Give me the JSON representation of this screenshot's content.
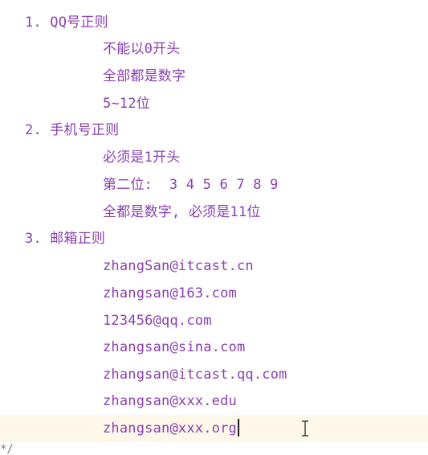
{
  "editor": {
    "lines": [
      {
        "kind": "heading",
        "text": "1. QQ号正则"
      },
      {
        "kind": "sub",
        "text": "不能以0开头"
      },
      {
        "kind": "sub",
        "text": "全部都是数字"
      },
      {
        "kind": "sub",
        "text": "5~12位"
      },
      {
        "kind": "heading",
        "text": "2. 手机号正则"
      },
      {
        "kind": "sub",
        "text": "必须是1开头"
      },
      {
        "kind": "sub",
        "text": "第二位:  3 4 5 6 7 8 9"
      },
      {
        "kind": "sub",
        "text": "全都是数字, 必须是11位"
      },
      {
        "kind": "heading",
        "text": "3. 邮箱正则"
      },
      {
        "kind": "sub",
        "text": "zhangSan@itcast.cn"
      },
      {
        "kind": "sub",
        "text": "zhangsan@163.com"
      },
      {
        "kind": "sub",
        "text": "123456@qq.com"
      },
      {
        "kind": "sub",
        "text": "zhangsan@sina.com"
      },
      {
        "kind": "sub",
        "text": "zhangsan@itcast.qq.com"
      },
      {
        "kind": "sub",
        "text": "zhangsan@xxx.edu"
      },
      {
        "kind": "sub",
        "text": "zhangsan@xxx.org"
      }
    ],
    "comment_tail": "*/",
    "cursor_line_index": 15,
    "colors": {
      "text": "#8a3fb0",
      "current_line_bg": "#fdf8ea",
      "caret": "#1b1b1b",
      "background": "#ffffff"
    },
    "icons": {
      "mouse_cursor": "text-ibeam-cursor"
    }
  }
}
